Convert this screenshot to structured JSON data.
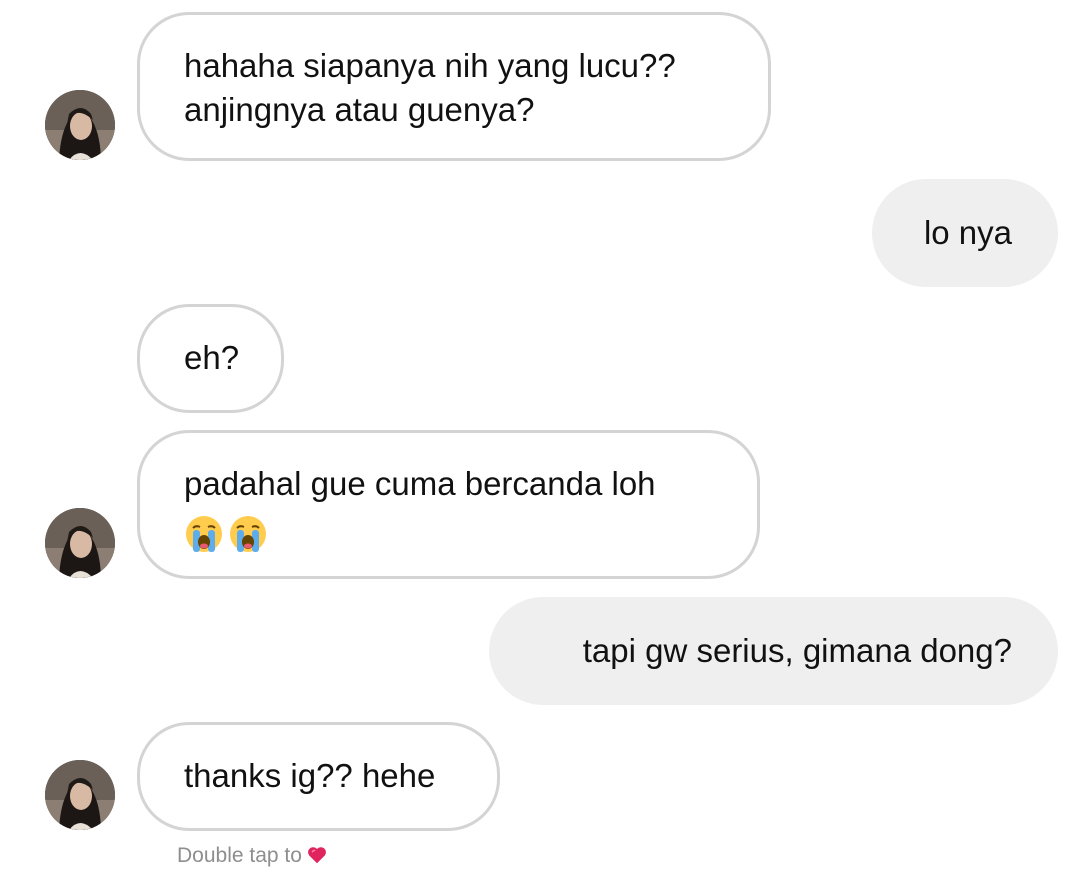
{
  "messages": [
    {
      "direction": "incoming",
      "lines": [
        "hahaha siapanya nih yang lucu??",
        "anjingnya atau guenya?"
      ]
    },
    {
      "direction": "outgoing",
      "lines": [
        "lo nya"
      ]
    },
    {
      "direction": "incoming",
      "lines": [
        "eh?"
      ]
    },
    {
      "direction": "incoming",
      "lines": [
        "padahal gue cuma bercanda loh"
      ],
      "emoji": [
        "loudly-crying-face-icon",
        "loudly-crying-face-icon"
      ]
    },
    {
      "direction": "outgoing",
      "lines": [
        "tapi gw serius, gimana dong?"
      ]
    },
    {
      "direction": "incoming",
      "lines": [
        "thanks ig?? hehe"
      ]
    }
  ],
  "footer": {
    "double_tap_text": "Double tap to",
    "icon": "red-heart-icon"
  },
  "colors": {
    "incoming_border": "#d4d4d4",
    "outgoing_background": "#efefef",
    "hint_text": "#8e8e8e",
    "heart": "#e0245e"
  }
}
